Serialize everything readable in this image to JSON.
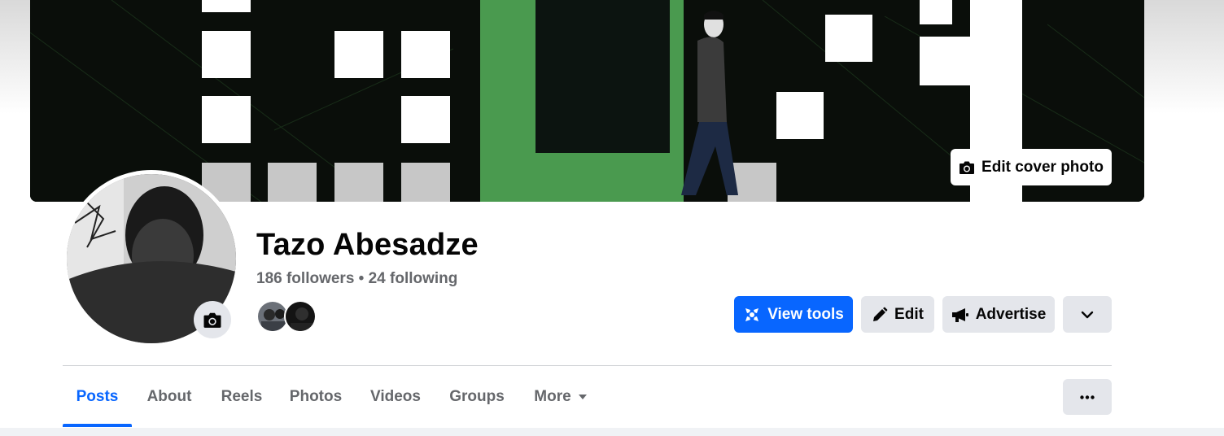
{
  "cover": {
    "edit_label": "Edit cover photo",
    "icon": "camera-icon"
  },
  "profile": {
    "name": "Tazo Abesadze",
    "followers": "186 followers",
    "separator": "•",
    "following": "24 following",
    "avatar_camera_icon": "camera-icon"
  },
  "actions": {
    "view_tools": "View tools",
    "edit": "Edit",
    "advertise": "Advertise",
    "dropdown_icon": "chevron-down-icon"
  },
  "tabs": [
    {
      "label": "Posts",
      "active": true
    },
    {
      "label": "About",
      "active": false
    },
    {
      "label": "Reels",
      "active": false
    },
    {
      "label": "Photos",
      "active": false
    },
    {
      "label": "Videos",
      "active": false
    },
    {
      "label": "Groups",
      "active": false
    },
    {
      "label": "More",
      "active": false
    }
  ],
  "colors": {
    "accent": "#0866ff",
    "secondary_button": "#e4e6eb",
    "muted_text": "#65676b",
    "text": "#050505"
  }
}
